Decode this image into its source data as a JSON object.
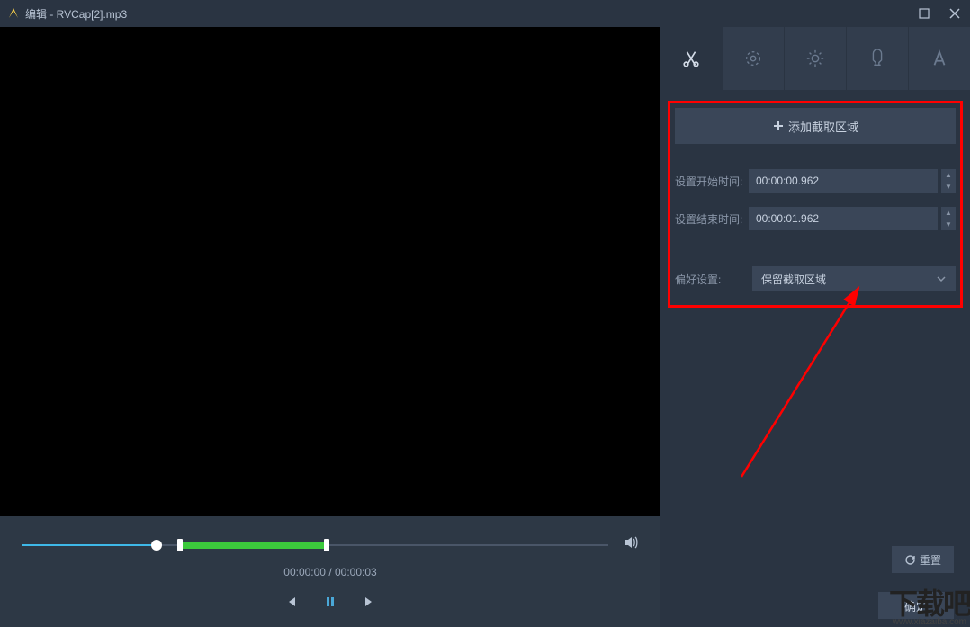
{
  "titlebar": {
    "title": "编辑 - RVCap[2].mp3"
  },
  "player": {
    "time_current": "00:00:00",
    "time_total": "00:00:03"
  },
  "tools": {
    "add_region_label": "添加截取区域",
    "start_time_label": "设置开始时间:",
    "start_time_value": "00:00:00.962",
    "end_time_label": "设置结束时间:",
    "end_time_value": "00:00:01.962",
    "preference_label": "偏好设置:",
    "preference_value": "保留截取区域",
    "reset_label": "重置",
    "ok_label": "确定"
  },
  "watermark": {
    "brand": "下载吧",
    "url": "www.xiazaiba.com"
  }
}
